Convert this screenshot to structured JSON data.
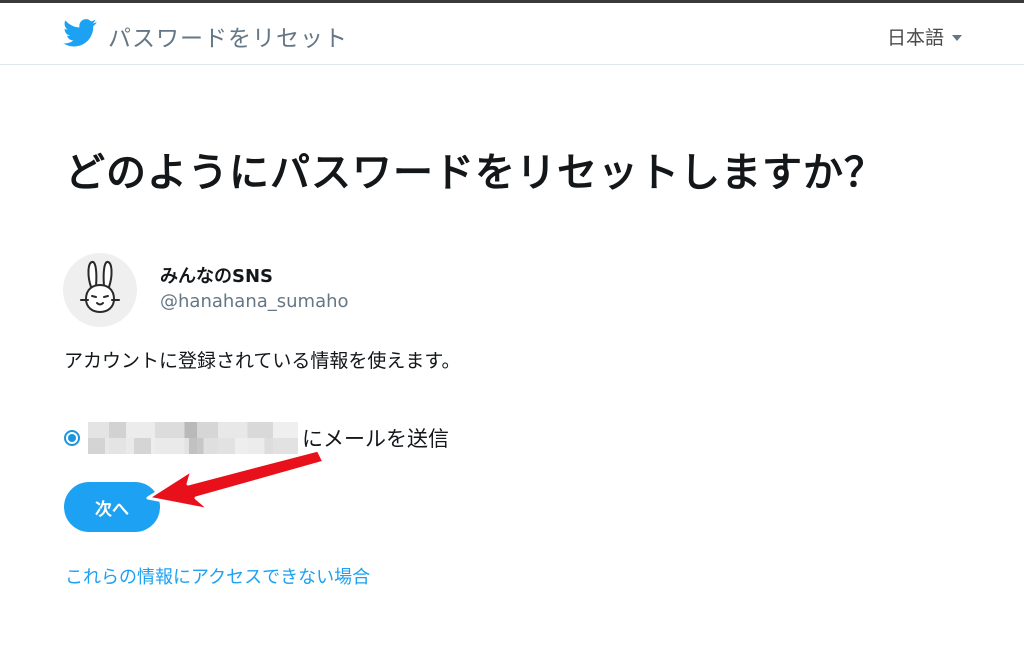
{
  "header": {
    "title": "パスワードをリセット",
    "language": "日本語"
  },
  "main": {
    "heading": "どのようにパスワードをリセットしますか？",
    "account": {
      "display_name": "みんなのSNS",
      "handle": "@hanahana_sumaho"
    },
    "info_text": "アカウントに登録されている情報を使えます。",
    "option": {
      "label": "にメールを送信",
      "selected": true
    },
    "next_button": "次へ",
    "help_link": "これらの情報にアクセスできない場合"
  },
  "icons": {
    "logo": "twitter-bird-icon",
    "language_caret": "caret-down-icon",
    "annotation": "red-arrow-icon"
  },
  "colors": {
    "brand": "#1da1f2",
    "annotation": "#e8111b"
  }
}
